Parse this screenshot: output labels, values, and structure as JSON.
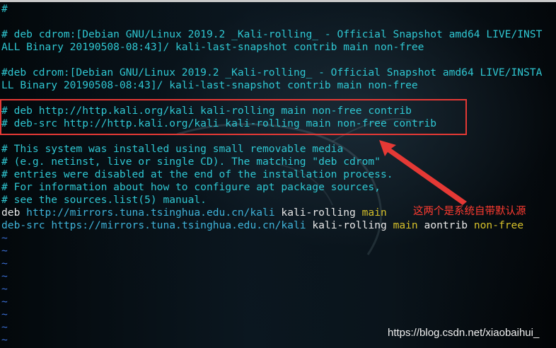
{
  "lines": {
    "l0": "#",
    "l2": "# deb cdrom:[Debian GNU/Linux 2019.2 _Kali-rolling_ - Official Snapshot amd64 LIVE/INST",
    "l3": "ALL Binary 20190508-08:43]/ kali-last-snapshot contrib main non-free",
    "l5": "#deb cdrom:[Debian GNU/Linux 2019.2 _Kali-rolling_ - Official Snapshot amd64 LIVE/INSTA",
    "l6": "LL Binary 20190508-08:43]/ kali-last-snapshot contrib main non-free",
    "l8": "# deb http://http.kali.org/kali kali-rolling main non-free contrib",
    "l9": "# deb-src http://http.kali.org/kali kali-rolling main non-free contrib",
    "l11": "# This system was installed using small removable media",
    "l12": "# (e.g. netinst, live or single CD). The matching \"deb cdrom\"",
    "l13": "# entries were disabled at the end of the installation process.",
    "l14": "# For information about how to configure apt package sources,",
    "l15": "# see the sources.list(5) manual."
  },
  "deb_line": {
    "keyword": "deb",
    "url": "http://mirrors.tuna.tsinghua.edu.cn/kali",
    "dist": "kali-rolling",
    "component": "main"
  },
  "debsrc_line": {
    "keyword": "deb-src",
    "url": "https://mirrors.tuna.tsinghua.edu.cn/kali",
    "dist": "kali-rolling",
    "component1": "main",
    "component2": "aontrib",
    "component3": "non-free"
  },
  "tilde": "~",
  "annotation": "这两个是系统自带默认源",
  "watermark": "https://blog.csdn.net/xiaobaihui_",
  "colors": {
    "comment": "#2fc7d2",
    "keyword": "#e8e8e8",
    "url": "#3fb3d9",
    "component": "#d6c02a",
    "highlight_border": "#e53935",
    "annotation": "#ff3b30",
    "tilde": "#3b6fd6"
  }
}
